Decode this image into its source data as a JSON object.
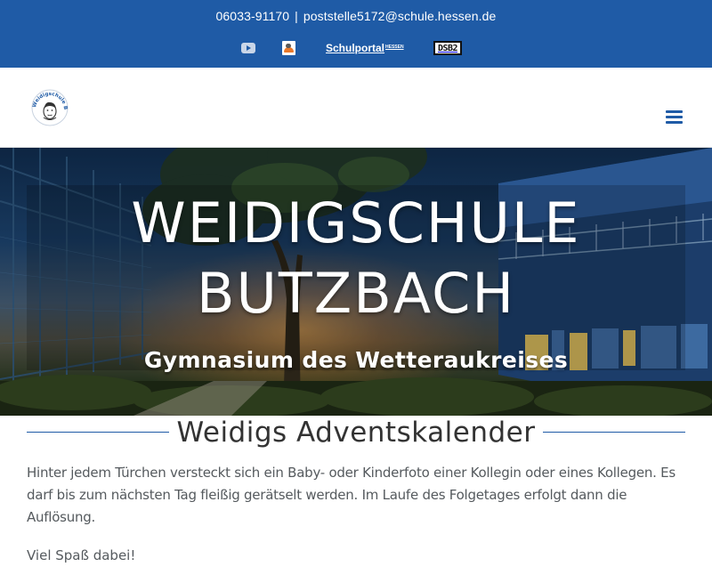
{
  "topbar": {
    "phone": "06033-91170",
    "separator": "|",
    "email": "poststelle5172@schule.hessen.de",
    "social": [
      {
        "icon": "youtube-icon",
        "label": ""
      },
      {
        "icon": "moodle-icon",
        "label": ""
      },
      {
        "icon": "schulportal-icon",
        "label": "Schulportal",
        "sup": "HESSEN"
      },
      {
        "icon": "dsb-icon",
        "label": "DSB2"
      }
    ]
  },
  "header": {
    "logo_text": "Weidigschule Butzbach",
    "menu_icon": "hamburger-menu-icon"
  },
  "hero": {
    "title_line1": "WEIDIGSCHULE",
    "title_line2": "BUTZBACH",
    "subtitle": "Gymnasium des Wetteraukreises"
  },
  "content": {
    "heading": "Weidigs Adventskalender",
    "paragraph1": "Hinter jedem Türchen versteckt sich ein Baby- oder Kinderfoto einer Kollegin oder eines Kollegen. Es darf bis zum nächsten Tag fleißig gerätselt werden. Im Laufe des Folgetages erfolgt dann die Auflösung.",
    "paragraph2": "Viel Spaß dabei!"
  },
  "colors": {
    "brand_blue": "#1f5ba6",
    "text": "#555a5e",
    "heading": "#333333"
  }
}
